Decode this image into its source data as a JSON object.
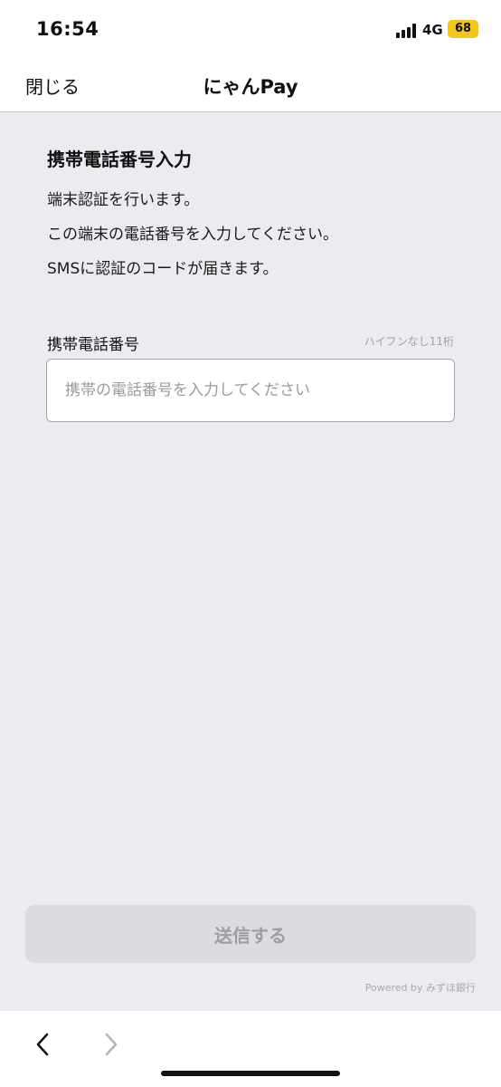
{
  "status_bar": {
    "time": "16:54",
    "network": "4G",
    "battery": "68"
  },
  "nav": {
    "close_label": "閉じる",
    "title": "にゃんPay"
  },
  "form": {
    "title": "携帯電話番号入力",
    "description": [
      "端末認証を行います。",
      "この端末の電話番号を入力してください。",
      "SMSに認証のコードが届きます。"
    ],
    "field_label": "携帯電話番号",
    "field_hint": "ハイフンなし11桁",
    "phone_value": "",
    "phone_placeholder": "携帯の電話番号を入力してください"
  },
  "submit": {
    "label": "送信する"
  },
  "footer": {
    "powered_by": "Powered by みずほ銀行"
  },
  "colors": {
    "background": "#ececf0",
    "button_disabled": "#dcdce0",
    "battery": "#f5c518"
  }
}
